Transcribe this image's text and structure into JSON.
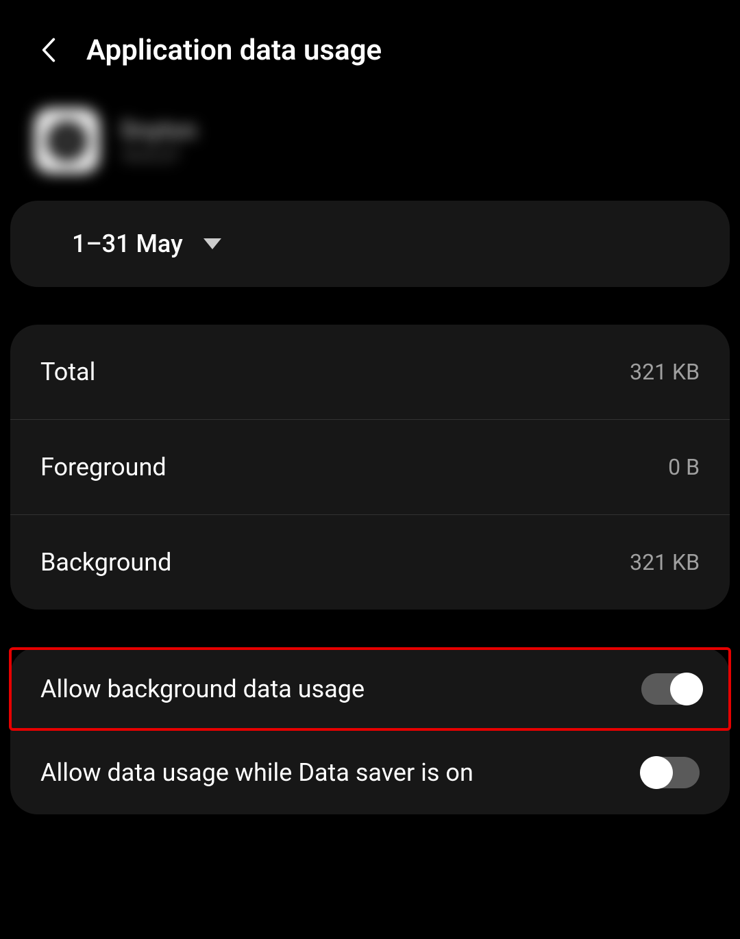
{
  "header": {
    "title": "Application data usage"
  },
  "app": {
    "name": "Snyton",
    "sub": "10.0.27"
  },
  "dateRange": {
    "text": "1–31 May"
  },
  "usage": {
    "total": {
      "label": "Total",
      "value": "321 KB"
    },
    "foreground": {
      "label": "Foreground",
      "value": "0 B"
    },
    "background": {
      "label": "Background",
      "value": "321 KB"
    }
  },
  "toggles": {
    "backgroundData": {
      "label": "Allow background data usage",
      "on": true
    },
    "dataSaver": {
      "label": "Allow data usage while Data saver is on",
      "on": false
    }
  }
}
